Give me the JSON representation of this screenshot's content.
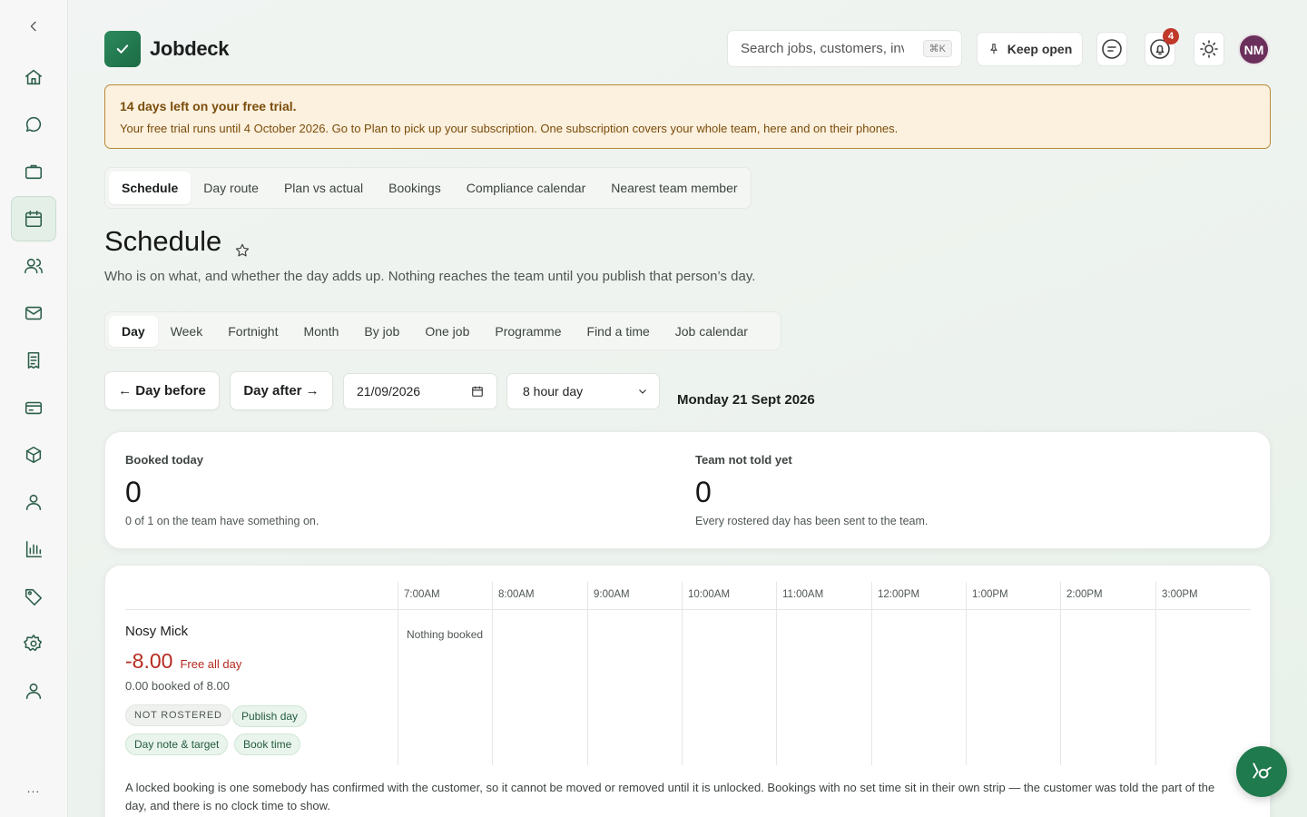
{
  "app": {
    "name": "Jobdeck"
  },
  "sidebar": {
    "items": [
      {
        "icon": "home-icon"
      },
      {
        "icon": "chat-icon"
      },
      {
        "icon": "briefcase-icon"
      },
      {
        "icon": "calendar-icon",
        "active": true
      },
      {
        "icon": "team-icon"
      },
      {
        "icon": "mail-icon"
      },
      {
        "icon": "receipt-icon"
      },
      {
        "icon": "card-icon"
      },
      {
        "icon": "box-icon"
      },
      {
        "icon": "person-icon"
      },
      {
        "icon": "chart-icon"
      },
      {
        "icon": "tag-icon"
      },
      {
        "icon": "gear-icon"
      },
      {
        "icon": "user-icon"
      }
    ],
    "more_label": "..."
  },
  "header": {
    "search_placeholder": "Search jobs, customers, invoices",
    "search_shortcut": "⌘K",
    "keep_open_label": "Keep open",
    "notification_count": "4",
    "avatar_initials": "NM"
  },
  "trial": {
    "title": "14 days left on your free trial.",
    "body": "Your free trial runs until 4 October 2026. Go to Plan to pick up your subscription. One subscription covers your whole team, here and on their phones."
  },
  "section_tabs": [
    {
      "label": "Schedule",
      "active": true
    },
    {
      "label": "Day route"
    },
    {
      "label": "Plan vs actual"
    },
    {
      "label": "Bookings"
    },
    {
      "label": "Compliance calendar"
    },
    {
      "label": "Nearest team member"
    }
  ],
  "page": {
    "title": "Schedule",
    "subtitle": "Who is on what, and whether the day adds up. Nothing reaches the team until you publish that person’s day."
  },
  "view_tabs": [
    {
      "label": "Day",
      "active": true
    },
    {
      "label": "Week"
    },
    {
      "label": "Fortnight"
    },
    {
      "label": "Month"
    },
    {
      "label": "By job"
    },
    {
      "label": "One job"
    },
    {
      "label": "Programme"
    },
    {
      "label": "Find a time"
    },
    {
      "label": "Job calendar"
    }
  ],
  "controls": {
    "day_before": "← Day before",
    "day_after": "Day after →",
    "date_value": "21/09/2026",
    "day_length": "8 hour day",
    "date_label": "Monday 21 Sept 2026"
  },
  "stats": {
    "booked": {
      "label": "Booked today",
      "value": "0",
      "note": "0 of 1 on the team have something on."
    },
    "not_told": {
      "label": "Team not told yet",
      "value": "0",
      "note": "Every rostered day has been sent to the team."
    }
  },
  "timeline": {
    "hours": [
      "7:00AM",
      "8:00AM",
      "9:00AM",
      "10:00AM",
      "11:00AM",
      "12:00PM",
      "1:00PM",
      "2:00PM",
      "3:00PM"
    ],
    "person": {
      "name": "Nosy Mick",
      "difference": "-8.00",
      "free_label": "Free all day",
      "booked_of": "0.00 booked of 8.00",
      "status": "NOT ROSTERED",
      "publish": "Publish day",
      "day_note": "Day note & target",
      "book_time": "Book time"
    },
    "empty_label": "Nothing booked",
    "footnote": "A locked booking is one somebody has confirmed with the customer, so it cannot be moved or removed until it is unlocked. Bookings with no set time sit in their own strip — the customer was told the part of the day, and there is no clock time to show."
  },
  "colors": {
    "brand": "#1f7a4d",
    "danger": "#b52a1f",
    "trial_bg": "#fcf0de",
    "trial_border": "#b78a36"
  }
}
